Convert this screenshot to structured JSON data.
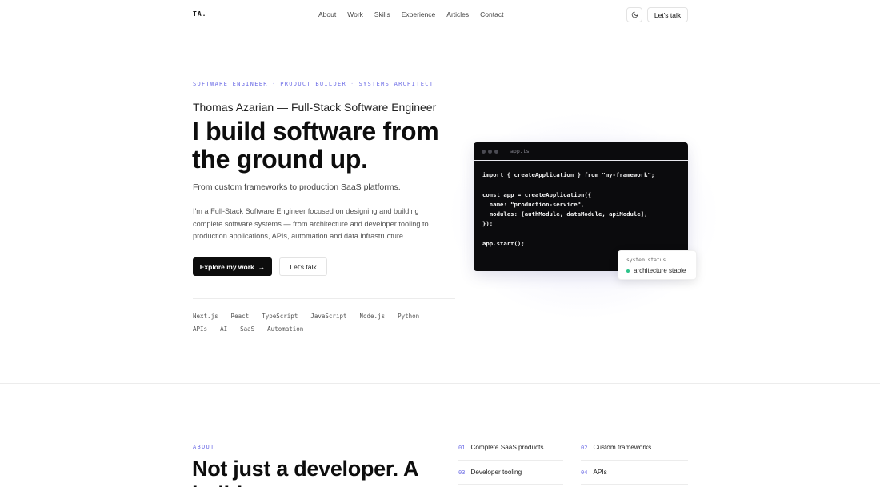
{
  "header": {
    "logo": "TA.",
    "nav": [
      "About",
      "Work",
      "Skills",
      "Experience",
      "Articles",
      "Contact"
    ],
    "theme_icon": "moon-icon",
    "cta_label": "Let's talk"
  },
  "hero": {
    "tagline": [
      "SOFTWARE ENGINEER",
      "PRODUCT BUILDER",
      "SYSTEMS ARCHITECT"
    ],
    "tagline_sep": "·",
    "subtitle": "Thomas Azarian — Full-Stack Software Engineer",
    "headline": "I build software from the ground up.",
    "lead": "From custom frameworks to production SaaS platforms.",
    "description": "I'm a Full-Stack Software Engineer focused on designing and building complete software systems — from architecture and developer tooling to production applications, APIs, automation and data infrastructure.",
    "primary_cta": "Explore my work",
    "primary_cta_arrow": "→",
    "secondary_cta": "Let's talk",
    "tech": [
      "Next.js",
      "React",
      "TypeScript",
      "JavaScript",
      "Node.js",
      "Python",
      "APIs",
      "AI",
      "SaaS",
      "Automation"
    ]
  },
  "code_window": {
    "filename": "app.ts",
    "code": "import { createApplication } from \"my-framework\";\n\nconst app = createApplication({\n  name: \"production-service\",\n  modules: [authModule, dataModule, apiModule],\n});\n\napp.start();",
    "status_label": "system.status",
    "status_value": "architecture stable",
    "status_color": "#2cc38a"
  },
  "about": {
    "tag": "ABOUT",
    "title": "Not just a developer. A builder.",
    "features": [
      {
        "num": "01",
        "label": "Complete SaaS products"
      },
      {
        "num": "02",
        "label": "Custom frameworks"
      },
      {
        "num": "03",
        "label": "Developer tooling"
      },
      {
        "num": "04",
        "label": "APIs"
      }
    ]
  },
  "colors": {
    "accent": "#6e6ee6",
    "dark": "#0d0d0d"
  }
}
